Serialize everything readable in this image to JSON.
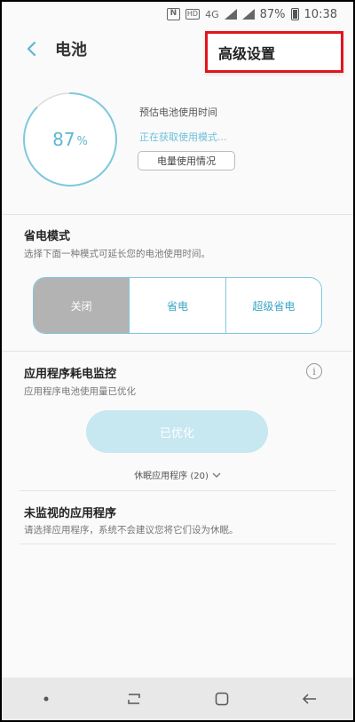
{
  "status_bar": {
    "nfc": "N",
    "hd": "HD",
    "network": "4G",
    "battery_pct": "87%",
    "time": "10:38"
  },
  "header": {
    "title": "电池",
    "back_icon": "chevron-left-icon"
  },
  "overflow_menu": {
    "item": "高级设置",
    "highlight_color": "#e2141c"
  },
  "battery": {
    "percent_value": 87,
    "percent_number": "87",
    "percent_sign": "%",
    "estimate_label": "预估电池使用时间",
    "estimate_status": "正在获取使用模式...",
    "usage_button": "电量使用情况",
    "ring_color": "#7fc8dd"
  },
  "power_mode": {
    "title": "省电模式",
    "description": "选择下面一种模式可延长您的电池使用时间。",
    "options": [
      {
        "label": "关闭",
        "active": true
      },
      {
        "label": "省电",
        "active": false
      },
      {
        "label": "超级省电",
        "active": false
      }
    ]
  },
  "app_monitor": {
    "title": "应用程序耗电监控",
    "description": "应用程序电池使用量已优化",
    "optimized_button": "已优化",
    "sleep_apps": "休眠应用程序 (20)",
    "info_icon": "info-icon"
  },
  "unmonitored": {
    "title": "未监视的应用程序",
    "description": "请选择应用程序，系统不会建议您将它们设为休眠。"
  },
  "nav_bar": {
    "icons": [
      "dot-icon",
      "recents-icon",
      "home-icon",
      "back-arrow-icon"
    ]
  },
  "colors": {
    "accent": "#5eb7d1",
    "active_segment": "#b3b3b3",
    "optimized_button_bg": "#c7e7f1"
  }
}
